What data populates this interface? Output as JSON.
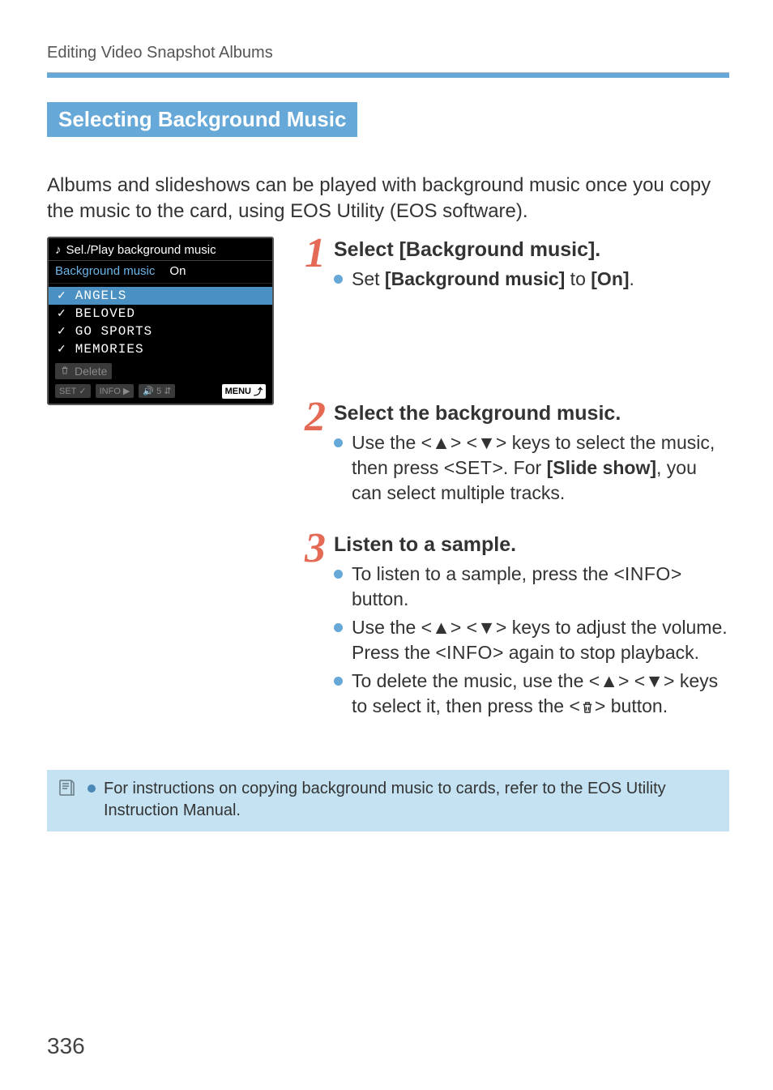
{
  "header": {
    "running_head": "Editing Video Snapshot Albums"
  },
  "section_title": "Selecting Background Music",
  "intro": "Albums and slideshows can be played with background music once you copy the music to the card, using EOS Utility (EOS software).",
  "cam_menu": {
    "title": "Sel./Play background music",
    "option_label": "Background music",
    "option_value": "On",
    "tracks": [
      "ANGELS",
      "BELOVED",
      "GO SPORTS",
      "MEMORIES"
    ],
    "delete_label": "Delete",
    "footer": {
      "set": "SET",
      "info": "INFO",
      "vol": "5",
      "menu": "MENU"
    }
  },
  "steps": {
    "s1": {
      "num": "1",
      "heading": "Select [Background music].",
      "b1_pre": "Set ",
      "b1_bold1": "[Background music]",
      "b1_mid": " to ",
      "b1_bold2": "[On]",
      "b1_post": "."
    },
    "s2": {
      "num": "2",
      "heading": "Select the background music.",
      "b1_a": "Use the <",
      "b1_b": "> <",
      "b1_c": "> keys to select the music, then press <",
      "b1_set": "SET",
      "b1_d": ">. For ",
      "b1_bold": "[Slide show]",
      "b1_e": ", you can select multiple tracks."
    },
    "s3": {
      "num": "3",
      "heading": "Listen to a sample.",
      "b1_a": "To listen to a sample, press the <",
      "b1_info": "INFO",
      "b1_b": "> button.",
      "b2_a": "Use the <",
      "b2_b": "> <",
      "b2_c": "> keys to adjust the volume. Press the <",
      "b2_info": "INFO",
      "b2_d": "> again to stop playback.",
      "b3_a": "To delete the music, use the <",
      "b3_b": "> <",
      "b3_c": "> keys to select it, then press the <",
      "b3_d": "> button."
    }
  },
  "note": "For instructions on copying background music to cards, refer to the EOS Utility Instruction Manual.",
  "page_number": "336"
}
